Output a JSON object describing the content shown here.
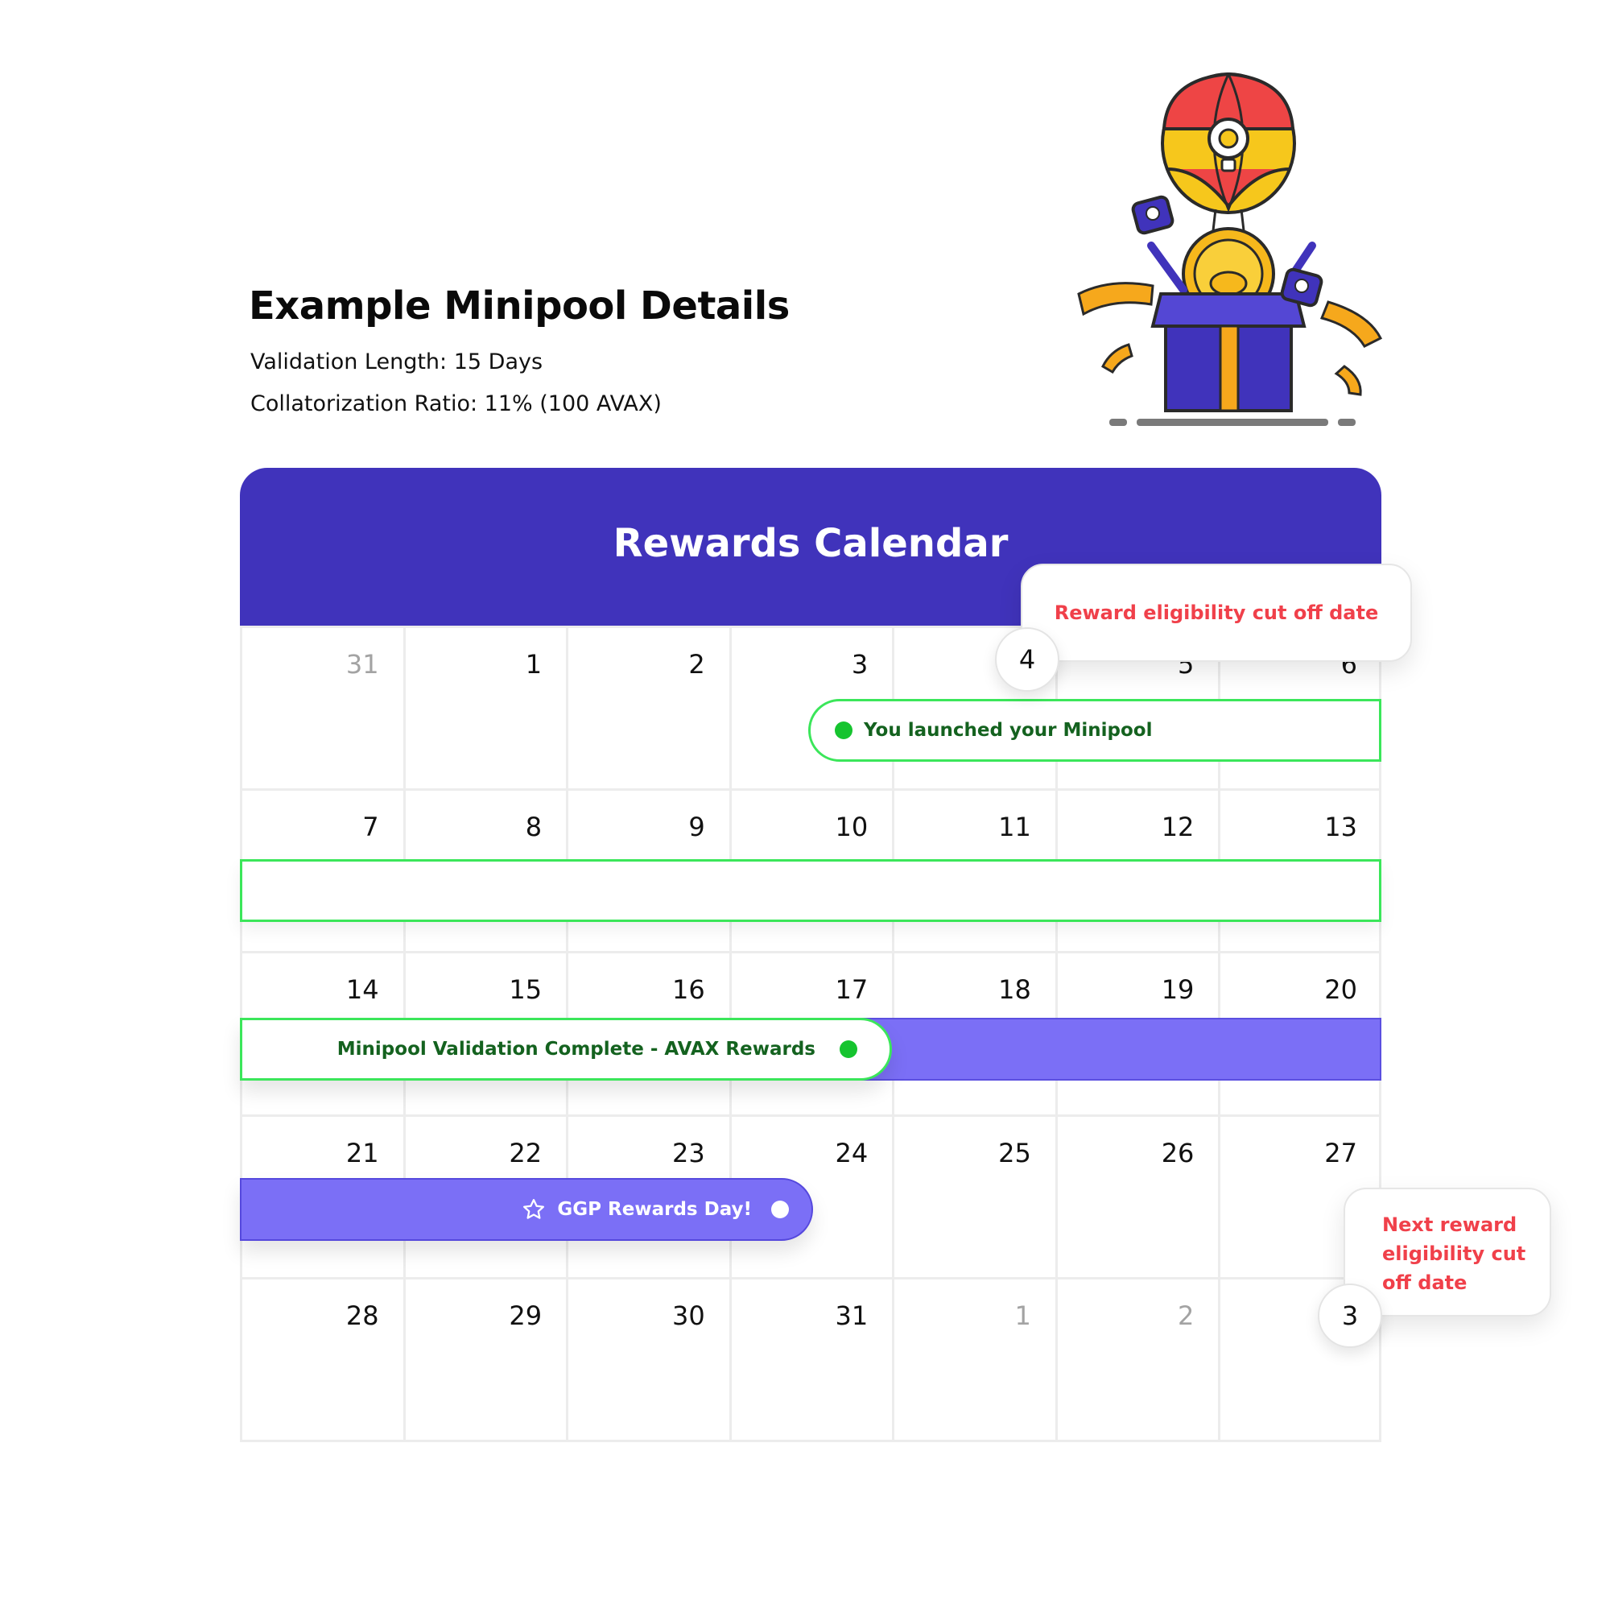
{
  "details": {
    "title": "Example Minipool Details",
    "validation_length": "Validation Length: 15 Days",
    "collateral_ratio": "Collatorization Ratio: 11% (100 AVAX)"
  },
  "calendar": {
    "title": "Rewards Calendar",
    "weeks": [
      [
        {
          "d": "31",
          "muted": true
        },
        {
          "d": "1"
        },
        {
          "d": "2"
        },
        {
          "d": "3"
        },
        {
          "d": "4"
        },
        {
          "d": "5"
        },
        {
          "d": "6"
        }
      ],
      [
        {
          "d": "7"
        },
        {
          "d": "8"
        },
        {
          "d": "9"
        },
        {
          "d": "10"
        },
        {
          "d": "11"
        },
        {
          "d": "12"
        },
        {
          "d": "13"
        }
      ],
      [
        {
          "d": "14"
        },
        {
          "d": "15"
        },
        {
          "d": "16"
        },
        {
          "d": "17"
        },
        {
          "d": "18"
        },
        {
          "d": "19"
        },
        {
          "d": "20"
        }
      ],
      [
        {
          "d": "21"
        },
        {
          "d": "22"
        },
        {
          "d": "23"
        },
        {
          "d": "24"
        },
        {
          "d": "25"
        },
        {
          "d": "26"
        },
        {
          "d": "27"
        }
      ],
      [
        {
          "d": "28"
        },
        {
          "d": "29"
        },
        {
          "d": "30"
        },
        {
          "d": "31"
        },
        {
          "d": "1",
          "muted": true
        },
        {
          "d": "2",
          "muted": true
        },
        {
          "d": "3"
        }
      ]
    ]
  },
  "events": {
    "launch": "You launched your Minipool",
    "complete": "Minipool Validation Complete - AVAX Rewards",
    "ggp": "GGP Rewards Day!"
  },
  "callouts": {
    "cutoff": "Reward eligibility cut off date",
    "cutoff_day": "4",
    "next_cutoff": "Next reward eligibility cut off date",
    "next_cutoff_day": "3"
  },
  "colors": {
    "header": "#4033bb",
    "event_purple": "#7b6ff6",
    "event_green_border": "#3be65a",
    "callout_text": "#f0404a"
  },
  "icons": {
    "illustration": "hot-air-balloon-gift-box-illustration",
    "ggp_event": "star-icon",
    "event_dot": "status-dot-icon"
  }
}
